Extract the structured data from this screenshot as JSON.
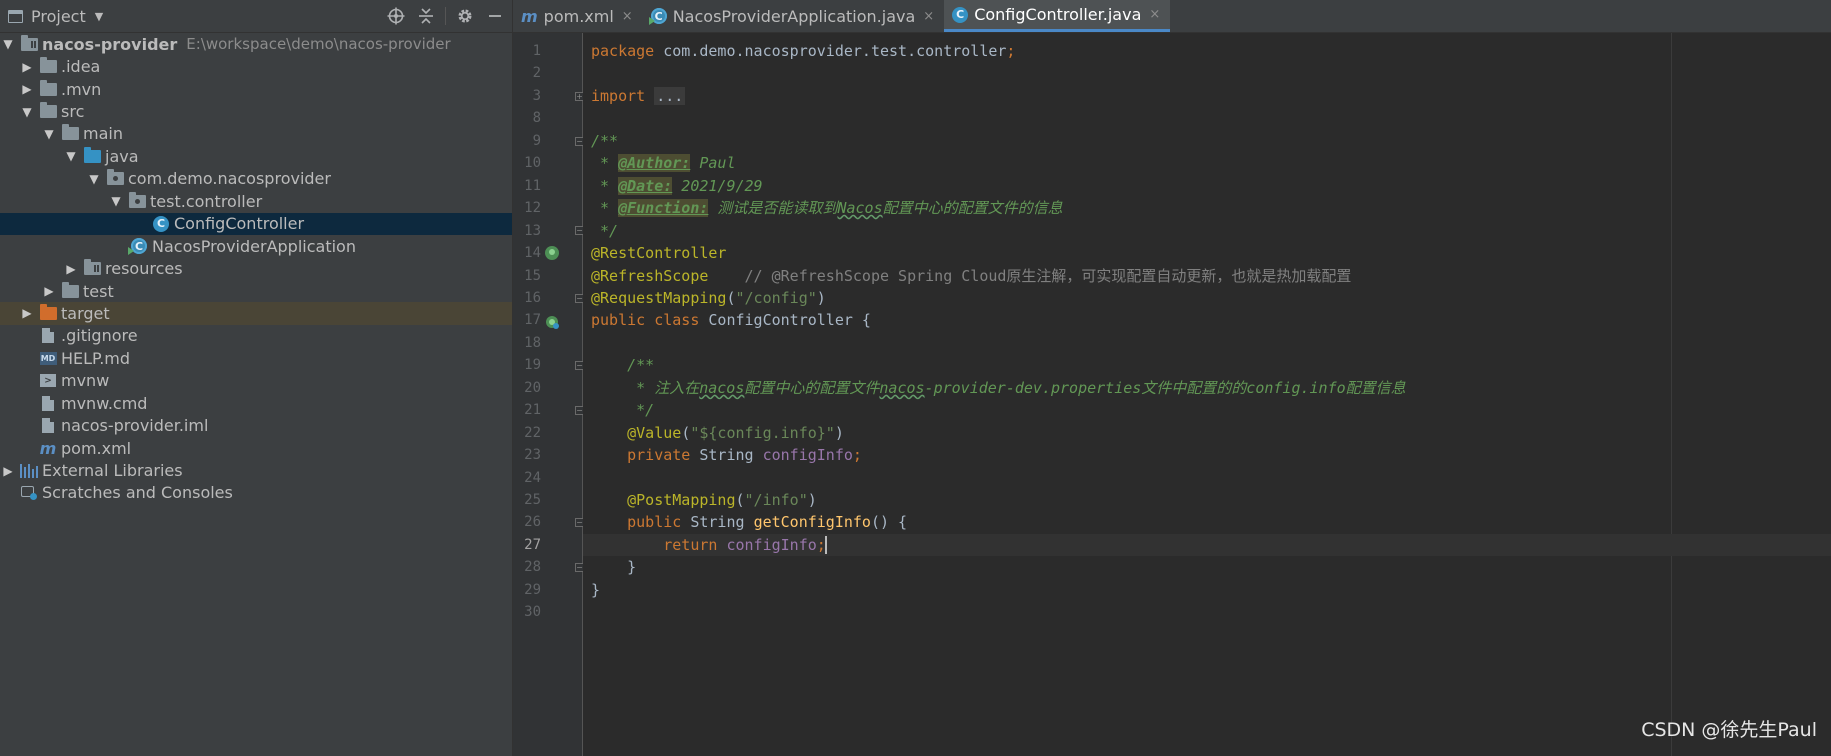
{
  "project_panel": {
    "title": "Project",
    "header_icons": [
      "target-icon",
      "collapse-icon",
      "gear-icon",
      "minimize-icon"
    ],
    "tree": [
      {
        "label": "nacos-provider",
        "path": "E:\\workspace\\demo\\nacos-provider",
        "expanded": true,
        "icon": "module-folder-icon"
      },
      {
        "label": ".idea",
        "expanded": false,
        "icon": "folder-icon"
      },
      {
        "label": ".mvn",
        "expanded": false,
        "icon": "folder-icon"
      },
      {
        "label": "src",
        "expanded": true,
        "icon": "folder-icon"
      },
      {
        "label": "main",
        "expanded": true,
        "icon": "folder-icon"
      },
      {
        "label": "java",
        "expanded": true,
        "icon": "source-folder-icon"
      },
      {
        "label": "com.demo.nacosprovider",
        "expanded": true,
        "icon": "package-icon"
      },
      {
        "label": "test.controller",
        "expanded": true,
        "icon": "package-icon"
      },
      {
        "label": "ConfigController",
        "icon": "java-class-icon",
        "selected": true
      },
      {
        "label": "NacosProviderApplication",
        "icon": "spring-boot-app-icon"
      },
      {
        "label": "resources",
        "expanded": false,
        "icon": "resources-folder-icon"
      },
      {
        "label": "test",
        "expanded": false,
        "icon": "folder-icon"
      },
      {
        "label": "target",
        "expanded": false,
        "icon": "excluded-folder-icon"
      },
      {
        "label": ".gitignore",
        "icon": "file-icon"
      },
      {
        "label": "HELP.md",
        "icon": "markdown-icon"
      },
      {
        "label": "mvnw",
        "icon": "terminal-file-icon"
      },
      {
        "label": "mvnw.cmd",
        "icon": "file-icon"
      },
      {
        "label": "nacos-provider.iml",
        "icon": "file-icon"
      },
      {
        "label": "pom.xml",
        "icon": "maven-icon"
      },
      {
        "label": "External Libraries",
        "expanded": false,
        "icon": "libraries-icon"
      },
      {
        "label": "Scratches and Consoles",
        "icon": "scratches-icon"
      }
    ]
  },
  "tabs": [
    {
      "label": "pom.xml",
      "icon": "maven-icon",
      "close": "×"
    },
    {
      "label": "NacosProviderApplication.java",
      "icon": "spring-boot-app-icon",
      "close": "×"
    },
    {
      "label": "ConfigController.java",
      "icon": "java-class-icon",
      "close": "×",
      "active": true
    }
  ],
  "editor": {
    "current_line": 27,
    "lines": [
      {
        "n": "1",
        "tokens": [
          [
            "kw",
            "package "
          ],
          [
            "pl",
            "com.demo.nacosprovider.test.controller"
          ],
          [
            "kw",
            ";"
          ]
        ]
      },
      {
        "n": "2",
        "tokens": []
      },
      {
        "n": "3",
        "tokens": [
          [
            "kw",
            "import "
          ],
          [
            "fold",
            "..."
          ]
        ],
        "fold": "+"
      },
      {
        "n": "8",
        "tokens": []
      },
      {
        "n": "9",
        "tokens": [
          [
            "dc",
            "/**"
          ]
        ],
        "fold": "-"
      },
      {
        "n": "10",
        "tokens": [
          [
            "dc",
            " * "
          ],
          [
            "dtag",
            "@Author:"
          ],
          [
            "dc",
            " Paul"
          ]
        ]
      },
      {
        "n": "11",
        "tokens": [
          [
            "dc",
            " * "
          ],
          [
            "dtag",
            "@Date:"
          ],
          [
            "dc",
            " 2021/9/29"
          ]
        ]
      },
      {
        "n": "12",
        "tokens": [
          [
            "dc",
            " * "
          ],
          [
            "dtag",
            "@Function:"
          ],
          [
            "dc",
            " 测试是否能读取到"
          ],
          [
            "dctypo",
            "Nacos"
          ],
          [
            "dc",
            "配置中心的配置文件的信息"
          ]
        ]
      },
      {
        "n": "13",
        "tokens": [
          [
            "dc",
            " */"
          ]
        ],
        "fold": "-"
      },
      {
        "n": "14",
        "tokens": [
          [
            "an",
            "@RestController"
          ]
        ],
        "gutter": "bean"
      },
      {
        "n": "15",
        "tokens": [
          [
            "an",
            "@RefreshScope"
          ],
          [
            "cm",
            "    // @RefreshScope Spring Cloud原生注解，可实现配置自动更新，也就是热加载配置"
          ]
        ]
      },
      {
        "n": "16",
        "tokens": [
          [
            "an",
            "@RequestMapping"
          ],
          [
            "pl",
            "("
          ],
          [
            "st",
            "\"/config\""
          ],
          [
            "pl",
            ")"
          ]
        ],
        "fold": "-"
      },
      {
        "n": "17",
        "tokens": [
          [
            "kw",
            "public class "
          ],
          [
            "pl",
            "ConfigController {"
          ]
        ],
        "gutter": "spring"
      },
      {
        "n": "18",
        "tokens": []
      },
      {
        "n": "19",
        "tokens": [
          [
            "dc",
            "    /**"
          ]
        ],
        "fold": "-"
      },
      {
        "n": "20",
        "tokens": [
          [
            "dc",
            "     * 注入在"
          ],
          [
            "dctypo",
            "nacos"
          ],
          [
            "dc",
            "配置中心的配置文件"
          ],
          [
            "dctypo",
            "nacos"
          ],
          [
            "dc",
            "-provider-dev.properties文件中配置的的config.info配置信息"
          ]
        ]
      },
      {
        "n": "21",
        "tokens": [
          [
            "dc",
            "     */"
          ]
        ],
        "fold": "-"
      },
      {
        "n": "22",
        "tokens": [
          [
            "an",
            "    @Value"
          ],
          [
            "pl",
            "("
          ],
          [
            "st",
            "\"${config.info}\""
          ],
          [
            "pl",
            ")"
          ]
        ]
      },
      {
        "n": "23",
        "tokens": [
          [
            "kw",
            "    private "
          ],
          [
            "pl",
            "String "
          ],
          [
            "fd",
            "configInfo"
          ],
          [
            "kw",
            ";"
          ]
        ]
      },
      {
        "n": "24",
        "tokens": []
      },
      {
        "n": "25",
        "tokens": [
          [
            "an",
            "    @PostMapping"
          ],
          [
            "pl",
            "("
          ],
          [
            "st",
            "\"/info\""
          ],
          [
            "pl",
            ")"
          ]
        ]
      },
      {
        "n": "26",
        "tokens": [
          [
            "kw",
            "    public "
          ],
          [
            "pl",
            "String "
          ],
          [
            "fn",
            "getConfigInfo"
          ],
          [
            "pl",
            "() {"
          ]
        ],
        "fold": "-"
      },
      {
        "n": "27",
        "tokens": [
          [
            "kw",
            "        return "
          ],
          [
            "fd",
            "configInfo"
          ],
          [
            "kw",
            ";"
          ],
          [
            "caret",
            ""
          ]
        ]
      },
      {
        "n": "28",
        "tokens": [
          [
            "pl",
            "    }"
          ]
        ],
        "fold": "-"
      },
      {
        "n": "29",
        "tokens": [
          [
            "pl",
            "}"
          ]
        ]
      },
      {
        "n": "30",
        "tokens": []
      }
    ]
  },
  "watermark": "CSDN @徐先生Paul"
}
